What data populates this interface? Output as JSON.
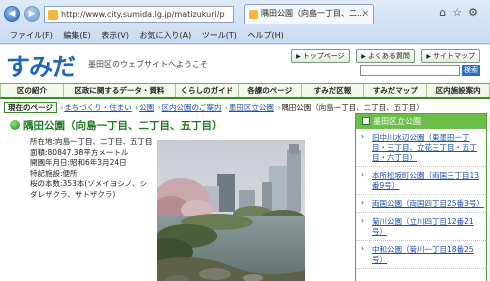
{
  "browser": {
    "url": "http://www.city.sumida.lg.jp/matizukuri/p",
    "tab_title": "隅田公園（向島一丁目、二...",
    "menu": [
      "ファイル(F)",
      "編集(E)",
      "表示(V)",
      "お気に入り(A)",
      "ツール(T)",
      "ヘルプ(H)"
    ]
  },
  "site": {
    "logo": "すみだ",
    "tagline": "墨田区のウェブサイトへようこそ",
    "top_links": [
      "トップページ",
      "よくある質問",
      "サイトマップ"
    ],
    "search_button": "検索"
  },
  "gnav": [
    "区の紹介",
    "区政に関するデータ・資料",
    "くらしのガイド",
    "各課のページ",
    "すみだ区報",
    "すみだマップ",
    "区内施設案内"
  ],
  "breadcrumb": {
    "here": "現在のページ",
    "links": [
      "まちづくり・住まい",
      "公園",
      "区内公園のご案内",
      "墨田区立公園"
    ],
    "current": "隅田公園（向島一丁目、二丁目、五丁目）"
  },
  "page_title": "隅田公園（向島一丁目、二丁目、五丁目）",
  "info": {
    "address_label": "所在地:",
    "address_value": "向島一丁目、二丁目、五丁目",
    "area": "面積:80847.38平方メートル",
    "opened": "開園年月日:昭和6年3月24日",
    "facilities": "特記施設:便所",
    "trees": "桜の本数:353本(ソメイヨシノ、シダレザクラ、サトザクラ)"
  },
  "sidebar": {
    "title": "墨田区立公園",
    "items": [
      "旧中川水辺公園（東墨田一丁目・三丁目、立花三丁目・五丁目・六丁目）",
      "本所松坂町公園（両国三丁目13番9号）",
      "両国公園（両国四丁目25番3号）",
      "菊川公園（立川四丁目12番21号）",
      "中和公園（菊川一丁目18番25号）"
    ]
  }
}
